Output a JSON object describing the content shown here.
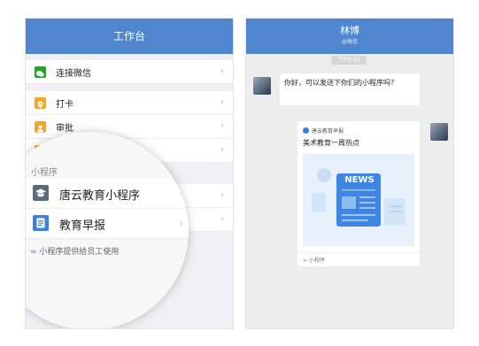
{
  "left": {
    "header_title": "工作台",
    "rows": [
      {
        "label": "连接微信",
        "icon": "wechat-icon",
        "color": "#1aad19"
      },
      {
        "label": "打卡",
        "icon": "location-pin-icon",
        "color": "#f5a623"
      },
      {
        "label": "审批",
        "icon": "person-icon",
        "color": "#f5a623"
      }
    ],
    "partial_row_icon_color": "#f5a623",
    "chevron": "›",
    "magnifier": {
      "section_title": "小程序",
      "items": [
        {
          "label": "唐云教育小程序",
          "icon": "graduation-cap-icon",
          "color": "#5a6b7d"
        },
        {
          "label": "教育早报",
          "icon": "document-icon",
          "color": "#3b82e0"
        }
      ],
      "footer": "小程序提供给员工使用"
    }
  },
  "right": {
    "contact_name": "林博",
    "contact_sub": "@微信",
    "timestamp": "下午5:25",
    "message": "你好，可以发送下你们的小程序吗？",
    "card": {
      "source": "唐云教育早报",
      "title": "美术教育一周热点",
      "banner_text": "NEWS",
      "footer": "小程序"
    }
  },
  "colors": {
    "accent": "#4f86cf",
    "chat_bg": "#ededed",
    "list_bg": "#efeff4"
  }
}
